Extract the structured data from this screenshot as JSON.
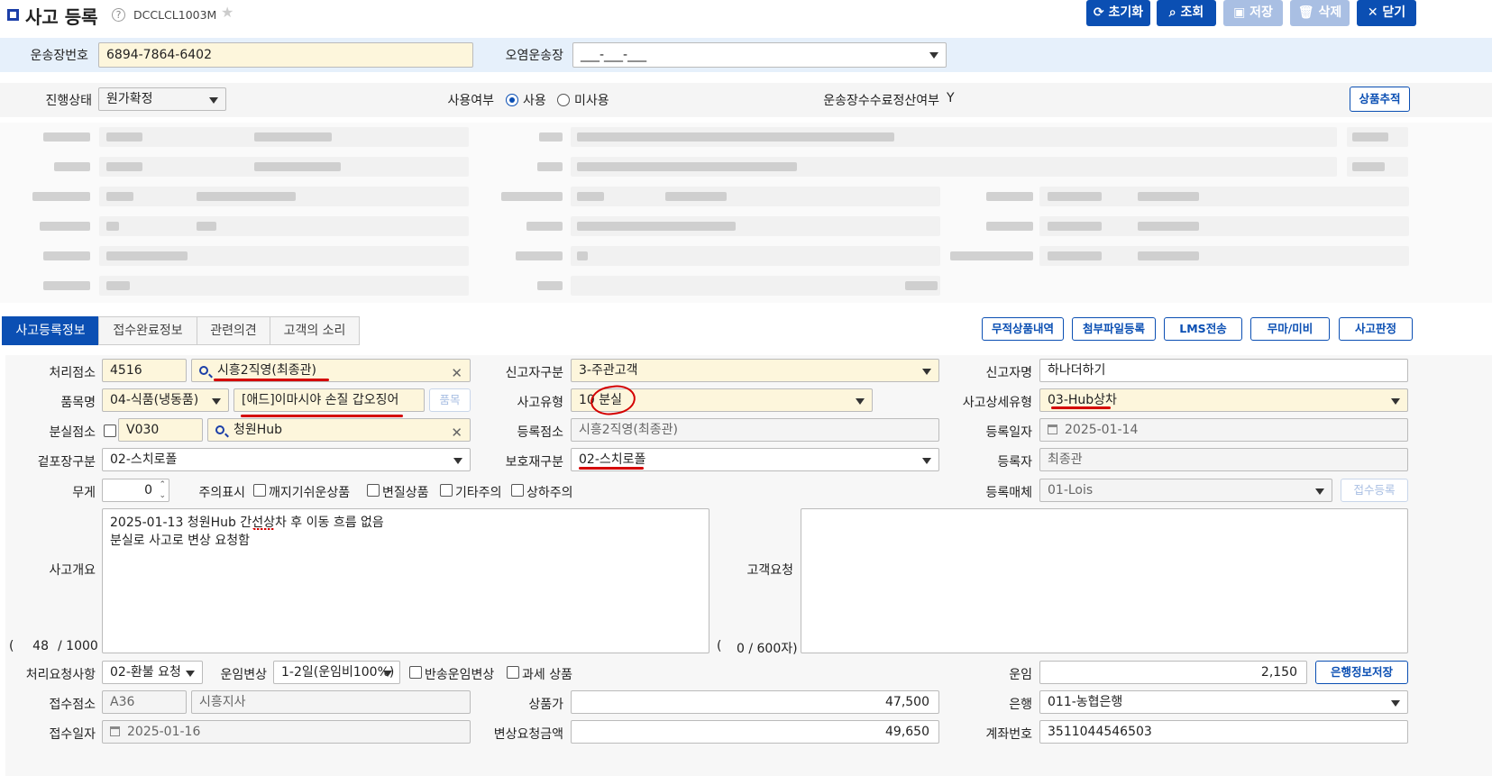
{
  "header": {
    "title": "사고 등록",
    "help": "?",
    "code": "DCCLCL1003M",
    "star": "★"
  },
  "toolbar": {
    "reset": "초기화",
    "search": "조회",
    "save": "저장",
    "delete": "삭제",
    "close": "닫기"
  },
  "top": {
    "waybill_label": "운송장번호",
    "waybill_value": "6894-7864-6402",
    "polluted_label": "오염운송장",
    "polluted_value": "___-___-___"
  },
  "status": {
    "progress_label": "진행상태",
    "progress_value": "원가확정",
    "use_label": "사용여부",
    "use_yes": "사용",
    "use_no": "미사용",
    "fee_label": "운송장수수료정산여부",
    "fee_value": "Y",
    "track_button": "상품추적"
  },
  "tabs": [
    "사고등록정보",
    "접수완료정보",
    "관련의견",
    "고객의 소리"
  ],
  "actions": {
    "no_waybill": "무적상품내역",
    "attach": "첨부파일등록",
    "lms": "LMS전송",
    "mark": "무마/미비",
    "judge": "사고판정"
  },
  "form": {
    "proc_point_label": "처리점소",
    "proc_point_code": "4516",
    "proc_point_name": "시흥2직영(최종관)",
    "reporter_type_label": "신고자구분",
    "reporter_type_value": "3-주관고객",
    "reporter_name_label": "신고자명",
    "reporter_name_value": "하나더하기",
    "item_label": "품목명",
    "item_value": "04-식품(냉동품)",
    "item_name": "[애드]이마시야 손질 갑오징어",
    "item_button": "품목",
    "accident_type_label": "사고유형",
    "accident_type_code": "10",
    "accident_type_name": "분실",
    "accident_detail_label": "사고상세유형",
    "accident_detail_value": "03-Hub상차",
    "lost_point_label": "분실점소",
    "lost_point_code": "V030",
    "lost_point_name": "청원Hub",
    "reg_point_label": "등록점소",
    "reg_point_value": "시흥2직영(최종관)",
    "reg_date_label": "등록일자",
    "reg_date_value": "2025-01-14",
    "outer_pack_label": "겉포장구분",
    "outer_pack_value": "02-스치로폴",
    "protect_label": "보호재구분",
    "protect_value": "02-스치로폴",
    "registrant_label": "등록자",
    "registrant_value": "최종관",
    "weight_label": "무게",
    "weight_value": "0",
    "caution_label": "주의표시",
    "caution_items": [
      "깨지기쉬운상품",
      "변질상품",
      "기타주의",
      "상하주의"
    ],
    "media_label": "등록매체",
    "media_value": "01-Lois",
    "receive_button": "접수등록",
    "summary_label": "사고개요",
    "summary_text": "2025-01-13 청원Hub 간선상차 후 이동 흐름 없음\n분실로 사고로 변상 요청함",
    "summary_count_open": "(",
    "summary_count": "48",
    "summary_max": "/ 1000",
    "request_label": "고객요청",
    "request_text": "",
    "request_count_open": "(",
    "request_count": "0 / 600자)",
    "proc_req_label": "처리요청사항",
    "proc_req_value": "02-환불 요청",
    "fare_change_label": "운임변상",
    "fare_change_value": "1-2일(운임비100%)",
    "return_fare": "반송운임변상",
    "taxable": "과세 상품",
    "fare_label": "운임",
    "fare_value": "2,150",
    "bank_save_button": "은행정보저장",
    "recv_point_label": "접수점소",
    "recv_point_code": "A36",
    "recv_point_name": "시흥지사",
    "price_label": "상품가",
    "price_value": "47,500",
    "bank_label": "은행",
    "bank_value": "011-농협은행",
    "recv_date_label": "접수일자",
    "recv_date_value": "2025-01-16",
    "claim_label": "변상요청금액",
    "claim_value": "49,650",
    "account_label": "계좌번호",
    "account_value": "3511044546503"
  }
}
